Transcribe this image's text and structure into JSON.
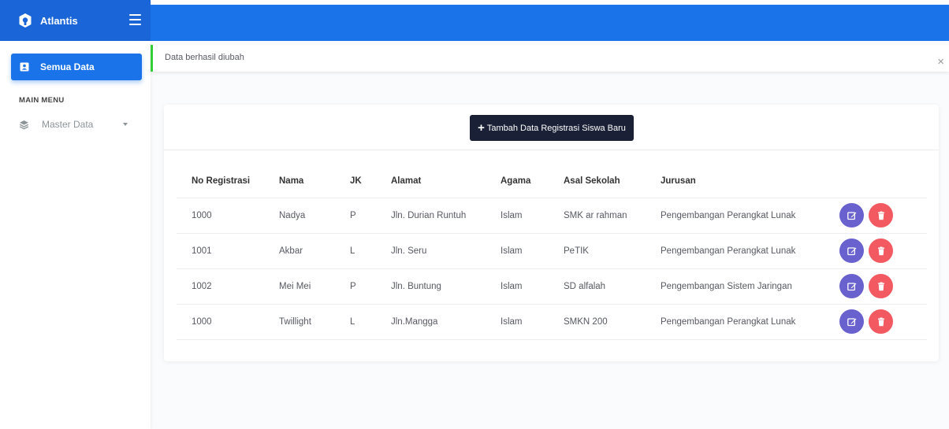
{
  "brand": {
    "name": "Atlantis"
  },
  "sidebar": {
    "active_item": "Semua Data",
    "section_title": "MAIN MENU",
    "items": [
      {
        "label": "Master Data"
      }
    ]
  },
  "alert": {
    "message": "Data berhasil diubah",
    "close": "×"
  },
  "card": {
    "add_button": "Tambah Data Registrasi Siswa Baru"
  },
  "table": {
    "columns": [
      "No Registrasi",
      "Nama",
      "JK",
      "Alamat",
      "Agama",
      "Asal Sekolah",
      "Jurusan"
    ],
    "rows": [
      [
        "1000",
        "Nadya",
        "P",
        "Jln. Durian Runtuh",
        "Islam",
        "SMK ar rahman",
        "Pengembangan Perangkat Lunak"
      ],
      [
        "1001",
        "Akbar",
        "L",
        "Jln. Seru",
        "Islam",
        "PeTIK",
        "Pengembangan Perangkat Lunak"
      ],
      [
        "1002",
        "Mei Mei",
        "P",
        "Jln. Buntung",
        "Islam",
        "SD alfalah",
        "Pengembangan Sistem Jaringan"
      ],
      [
        "1000",
        "Twillight",
        "L",
        "Jln.Mangga",
        "Islam",
        "SMKN 200",
        "Pengembangan Perangkat Lunak"
      ]
    ]
  },
  "colors": {
    "primary": "#1a73e8",
    "header": "#1a66d9",
    "dark": "#1a2035",
    "edit": "#6861ce",
    "delete": "#f25961",
    "success": "#31ce36"
  },
  "icons": {
    "logo": "atlantis-logo-icon",
    "menu": "hamburger-icon",
    "active_item": "id-card-icon",
    "master": "layers-icon",
    "edit": "edit-icon",
    "delete": "trash-icon"
  }
}
